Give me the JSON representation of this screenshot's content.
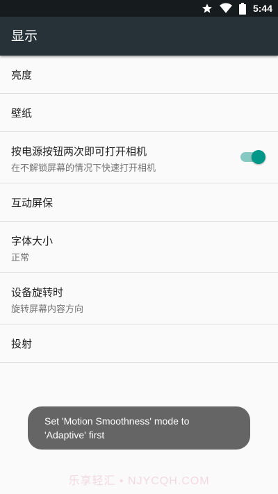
{
  "status_bar": {
    "time": "5:44",
    "icons": [
      "star-icon",
      "wifi-icon",
      "battery-icon"
    ]
  },
  "app_bar": {
    "title": "显示"
  },
  "settings": [
    {
      "title": "亮度"
    },
    {
      "title": "壁纸"
    },
    {
      "title": "按电源按钮两次即可打开相机",
      "subtitle": "在不解锁屏幕的情况下快速打开相机",
      "toggle": "on"
    },
    {
      "title": "互动屏保"
    },
    {
      "title": "字体大小",
      "subtitle": "正常"
    },
    {
      "title": "设备旋转时",
      "subtitle": "旋转屏幕内容方向"
    },
    {
      "title": "投射"
    }
  ],
  "toast": {
    "line1": "Set 'Motion Smoothness' mode to",
    "line2": "'Adaptive' first"
  },
  "watermark": "乐享轻汇 • NJYCQH.COM",
  "colors": {
    "app_bar": "#263238",
    "status_bar": "#161b1d",
    "accent": "#009688"
  }
}
